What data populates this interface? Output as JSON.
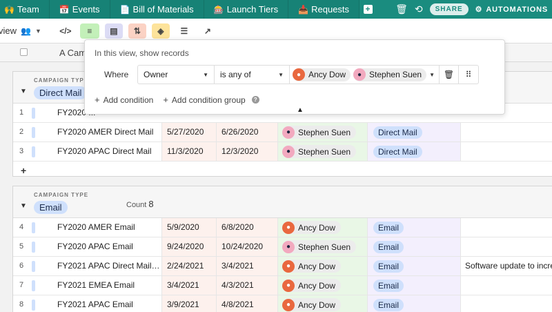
{
  "tabs": [
    {
      "icon": "🙌",
      "label": "Team"
    },
    {
      "icon": "📅",
      "label": "Events"
    },
    {
      "icon": "📄",
      "label": "Bill of Materials"
    },
    {
      "icon": "🎰",
      "label": "Launch Tiers"
    },
    {
      "icon": "📥",
      "label": "Requests"
    }
  ],
  "topbar": {
    "share_label": "SHARE",
    "automations_label": "AUTOMATIONS"
  },
  "toolbar": {
    "view_label": "view"
  },
  "grid": {
    "primary_field_label": "A",
    "hidden_field_label": "Campa"
  },
  "filter": {
    "title": "In this view, show records",
    "where_label": "Where",
    "field": "Owner",
    "operator": "is any of",
    "values": [
      "Ancy Dow",
      "Stephen Suen"
    ],
    "add_condition": "Add condition",
    "add_group": "Add condition group"
  },
  "groups": [
    {
      "group_field_label": "CAMPAIGN TYPE",
      "group_value": "Direct Mail",
      "rows": [
        {
          "num": "1",
          "name": "FY2020 ...",
          "start": "",
          "end": "",
          "owner": "",
          "owner_kind": "",
          "type": "",
          "notes": ""
        },
        {
          "num": "2",
          "name": "FY2020 AMER Direct Mail",
          "start": "5/27/2020",
          "end": "6/26/2020",
          "owner": "Stephen Suen",
          "owner_kind": "ste",
          "type": "Direct Mail",
          "notes": ""
        },
        {
          "num": "3",
          "name": "FY2020 APAC Direct Mail",
          "start": "11/3/2020",
          "end": "12/3/2020",
          "owner": "Stephen Suen",
          "owner_kind": "ste",
          "type": "Direct Mail",
          "notes": ""
        }
      ]
    },
    {
      "group_field_label": "CAMPAIGN TYPE",
      "group_value": "Email",
      "count_label": "Count",
      "count": "8",
      "rows": [
        {
          "num": "4",
          "name": "FY2020 AMER Email",
          "start": "5/9/2020",
          "end": "6/8/2020",
          "owner": "Ancy Dow",
          "owner_kind": "anc",
          "type": "Email",
          "notes": ""
        },
        {
          "num": "5",
          "name": "FY2020 APAC Email",
          "start": "9/24/2020",
          "end": "10/24/2020",
          "owner": "Stephen Suen",
          "owner_kind": "ste",
          "type": "Email",
          "notes": ""
        },
        {
          "num": "6",
          "name": "FY2021 APAC Direct Mail …",
          "start": "2/24/2021",
          "end": "3/4/2021",
          "owner": "Ancy Dow",
          "owner_kind": "anc",
          "type": "Email",
          "notes": "Software update to incre"
        },
        {
          "num": "7",
          "name": "FY2021 EMEA Email",
          "start": "3/4/2021",
          "end": "4/3/2021",
          "owner": "Ancy Dow",
          "owner_kind": "anc",
          "type": "Email",
          "notes": ""
        },
        {
          "num": "8",
          "name": "FY2021 APAC Email",
          "start": "3/9/2021",
          "end": "4/8/2021",
          "owner": "Ancy Dow",
          "owner_kind": "anc",
          "type": "Email",
          "notes": ""
        }
      ]
    }
  ]
}
